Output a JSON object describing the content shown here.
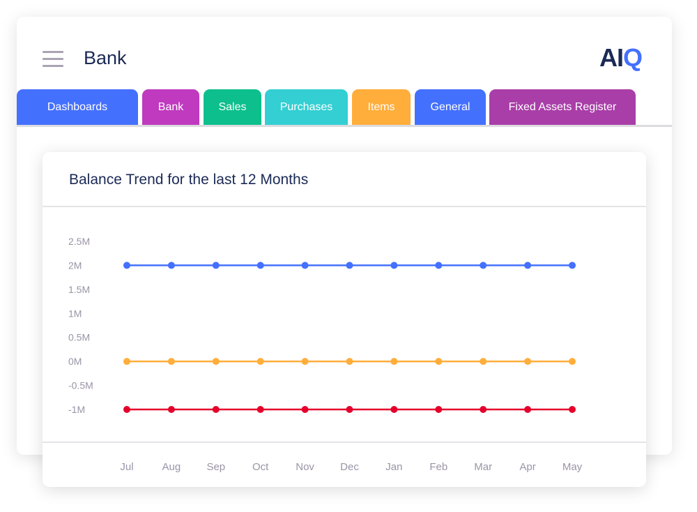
{
  "header": {
    "title": "Bank",
    "logo": {
      "part1": "AI",
      "part2": "Q"
    },
    "menu_icon": "hamburger-icon"
  },
  "tabs": [
    {
      "label": "Dashboards",
      "color": "#4470fe"
    },
    {
      "label": "Bank",
      "color": "#bf3abf"
    },
    {
      "label": "Sales",
      "color": "#0dbf8c"
    },
    {
      "label": "Purchases",
      "color": "#33cfd3"
    },
    {
      "label": "Items",
      "color": "#ffad3b"
    },
    {
      "label": "General",
      "color": "#4470fe"
    },
    {
      "label": "Fixed Assets Register",
      "color": "#a93ea8"
    }
  ],
  "card": {
    "title": "Balance Trend for the last 12 Months"
  },
  "chart_data": {
    "type": "line",
    "categories": [
      "Jul",
      "Aug",
      "Sep",
      "Oct",
      "Nov",
      "Dec",
      "Jan",
      "Feb",
      "Mar",
      "Apr",
      "May"
    ],
    "y_ticks": [
      "2.5M",
      "2M",
      "1.5M",
      "1M",
      "0.5M",
      "0M",
      "-0.5M",
      "-1M"
    ],
    "ylim": [
      -1000000,
      2500000
    ],
    "grid": false,
    "series": [
      {
        "color": "#4470fe",
        "values": [
          2000000,
          2000000,
          2000000,
          2000000,
          2000000,
          2000000,
          2000000,
          2000000,
          2000000,
          2000000,
          2000000
        ]
      },
      {
        "color": "#ffad3b",
        "values": [
          0,
          0,
          0,
          0,
          0,
          0,
          0,
          0,
          0,
          0,
          0
        ]
      },
      {
        "color": "#e4002b",
        "values": [
          -1000000,
          -1000000,
          -1000000,
          -1000000,
          -1000000,
          -1000000,
          -1000000,
          -1000000,
          -1000000,
          -1000000,
          -1000000
        ]
      }
    ]
  }
}
